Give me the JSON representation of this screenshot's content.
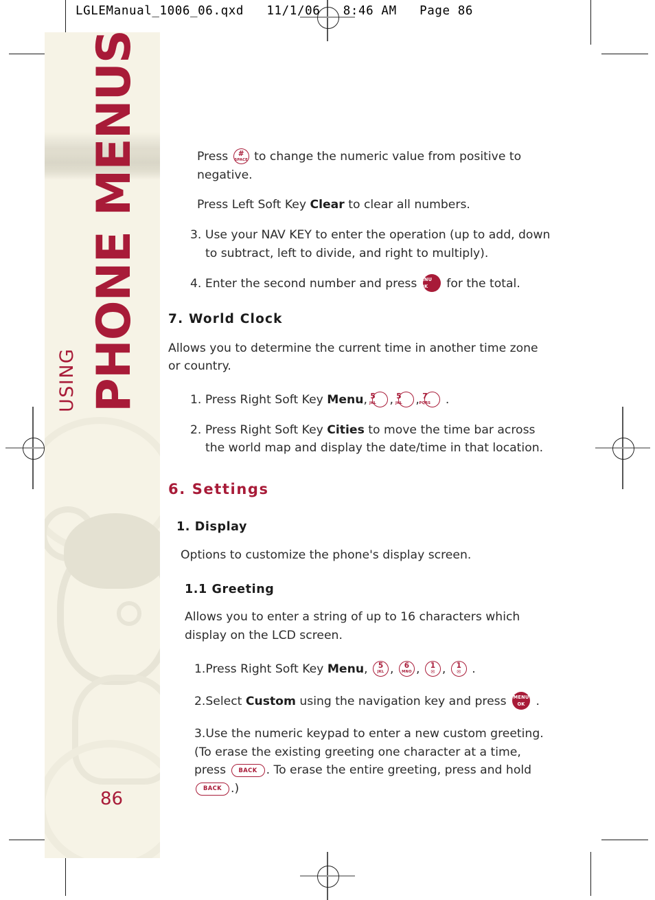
{
  "print_header": "LGLEManual_1006_06.qxd   11/1/06   8:46 AM   Page 86",
  "sidebar": {
    "title_main": "PHONE MENUS",
    "title_sub": "USING",
    "page_number": "86",
    "accent_color": "#a81b38",
    "background_color": "#f6f3e6"
  },
  "content": {
    "p_press_hash_1": "Press",
    "p_press_hash_2": "to change the numeric value from positive to negative.",
    "p_clear_1": "Press Left Soft Key",
    "p_clear_bold": "Clear",
    "p_clear_2": "to clear all numbers.",
    "step3_calc": "3. Use your NAV KEY to enter the operation (up to add, down to subtract, left to divide, and right to multiply).",
    "step4_calc_1": "4. Enter the second number and press",
    "step4_calc_2": "for the total.",
    "heading_world_clock": "7. World Clock",
    "world_clock_desc": "Allows you to determine the current time in another time zone or country.",
    "wc_step1_1": "1. Press Right Soft Key",
    "wc_step1_bold": "Menu",
    "wc_step1_comma": ",",
    "wc_step1_end": ".",
    "wc_step2_1": "2. Press Right Soft Key",
    "wc_step2_bold": "Cities",
    "wc_step2_2": "to move the time bar across the world map and display the date/time in that location.",
    "heading_settings": "6. Settings",
    "heading_display": "1. Display",
    "display_desc": "Options to customize the phone's display screen.",
    "heading_greeting": "1.1 Greeting",
    "greeting_desc": "Allows you to enter a string of up to 16 characters which display on the LCD screen.",
    "gr_step1_1": "1.Press Right Soft Key",
    "gr_step1_bold": "Menu",
    "gr_step1_comma": ",",
    "gr_step1_end": ".",
    "gr_step2_1": "2.Select",
    "gr_step2_bold": "Custom",
    "gr_step2_2": "using the navigation key and press",
    "gr_step2_3": ".",
    "gr_step3_a": "3.Use the numeric keypad to enter a new custom greeting. (To erase the existing greeting one character at a time, press",
    "gr_step3_b": ". To erase the entire greeting, press and hold",
    "gr_step3_c": ".)"
  },
  "keys": {
    "hash": {
      "top": "#",
      "bottom": "SPACE"
    },
    "menu_ok": {
      "line1": "MENU",
      "line2": "OK"
    },
    "k5": {
      "top": "5",
      "bottom": "JKL"
    },
    "k7": {
      "top": "7",
      "bottom": "PQRS"
    },
    "k6": {
      "top": "6",
      "bottom": "MNO"
    },
    "k1": {
      "top": "1",
      "bottom": "✉"
    },
    "back": {
      "label": "BACK"
    }
  }
}
